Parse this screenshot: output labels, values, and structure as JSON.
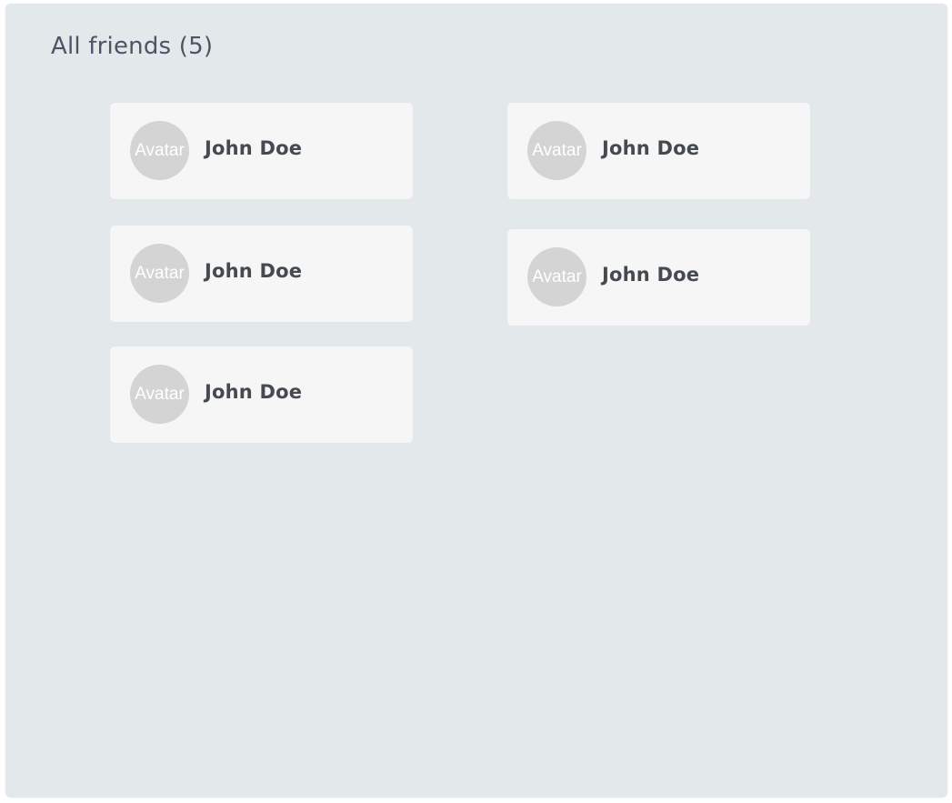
{
  "header": {
    "title": "All friends (5)"
  },
  "friends": [
    {
      "name": "John Doe",
      "avatar_text": "Avatar"
    },
    {
      "name": "John Doe",
      "avatar_text": "Avatar"
    },
    {
      "name": "John Doe",
      "avatar_text": "Avatar"
    },
    {
      "name": "John Doe",
      "avatar_text": "Avatar"
    },
    {
      "name": "John Doe",
      "avatar_text": "Avatar"
    }
  ],
  "colors": {
    "panel_background": "#e3e8eb",
    "card_background": "#f6f6f6",
    "avatar_background": "#d4d4d4",
    "title_text": "#4d5466",
    "name_text": "#454a50"
  }
}
